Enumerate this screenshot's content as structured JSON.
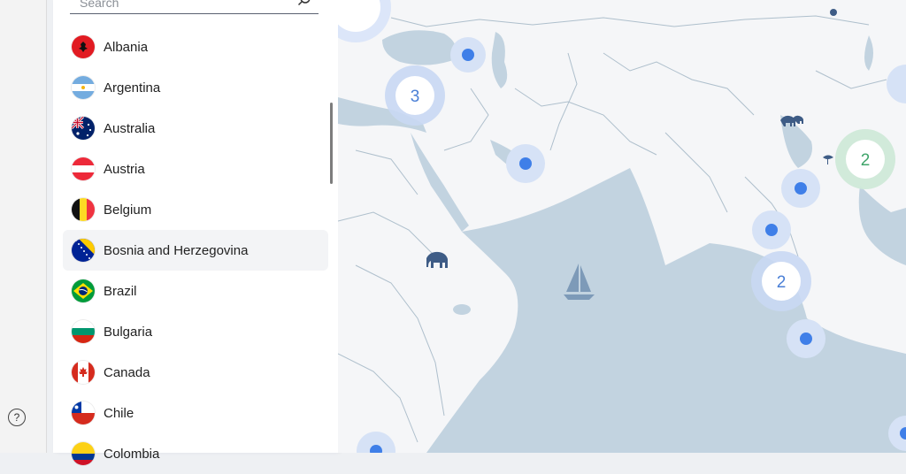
{
  "search": {
    "placeholder": "Search"
  },
  "countries": [
    {
      "name": "Albania",
      "flag": "albania-flag-icon"
    },
    {
      "name": "Argentina",
      "flag": "argentina-flag-icon"
    },
    {
      "name": "Australia",
      "flag": "australia-flag-icon"
    },
    {
      "name": "Austria",
      "flag": "austria-flag-icon"
    },
    {
      "name": "Belgium",
      "flag": "belgium-flag-icon"
    },
    {
      "name": "Bosnia and Herzegovina",
      "flag": "bosnia-flag-icon"
    },
    {
      "name": "Brazil",
      "flag": "brazil-flag-icon"
    },
    {
      "name": "Bulgaria",
      "flag": "bulgaria-flag-icon"
    },
    {
      "name": "Canada",
      "flag": "canada-flag-icon"
    },
    {
      "name": "Chile",
      "flag": "chile-flag-icon"
    },
    {
      "name": "Colombia",
      "flag": "colombia-flag-icon"
    }
  ],
  "help": {
    "icon": "help-circle-icon",
    "glyph": "?"
  },
  "map": {
    "clusters": [
      {
        "label": "3",
        "color": "#4a7fd6"
      },
      {
        "label": "2",
        "color": "#3fa46a"
      },
      {
        "label": "2",
        "color": "#4a7fd6"
      }
    ],
    "colors": {
      "ocean": "#c2d3e0",
      "land": "#f5f6f8",
      "border": "#aebfcc",
      "marker": "#3f7fe8",
      "halo": "#b9cdf2"
    }
  }
}
